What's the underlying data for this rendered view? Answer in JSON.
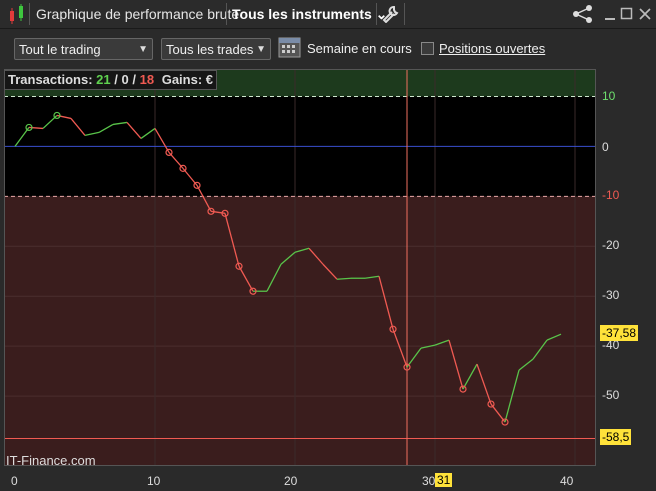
{
  "titlebar": {
    "title": "Graphique de performance brute",
    "instruments": "Tous les instruments ⌄",
    "colors": {
      "bg": "#2b2b2b"
    }
  },
  "toolbar": {
    "trading_select": "Tout le trading",
    "trades_select": "Tous les trades",
    "period_label": "Semaine en cours",
    "positions_label": "Positions ouvertes",
    "positions_checked": false
  },
  "info": {
    "label": "Transactions:",
    "wins": "21",
    "zero": "0",
    "losses": "18",
    "gains_label": "Gains: €",
    "sep": "/"
  },
  "watermark": "IT-Finance.com",
  "levels": {
    "upper": "10",
    "lower": "-10",
    "current": "-37,58",
    "min": "-58,5"
  },
  "crosshair_x_label": "31",
  "chart_data": {
    "type": "line",
    "x_ticks": [
      "0",
      "10",
      "20",
      "30",
      "40"
    ],
    "y_ticks": [
      "10",
      "0",
      "-10",
      "-20",
      "-30",
      "-40",
      "-50"
    ],
    "xlim": [
      0,
      41.5
    ],
    "ylim": [
      -64,
      15.5
    ],
    "x": [
      0,
      1,
      2,
      3,
      4,
      5,
      6,
      7,
      8,
      9,
      10,
      11,
      12,
      13,
      14,
      15,
      16,
      17,
      18,
      19,
      20,
      21,
      22,
      23,
      24,
      25,
      26,
      27,
      28,
      29,
      30,
      31,
      32,
      33,
      34,
      35,
      36,
      37,
      38,
      39
    ],
    "y": [
      0,
      3.8,
      3.6,
      6.2,
      5.6,
      2.2,
      2.8,
      4.4,
      4.8,
      1.6,
      3.6,
      -1.2,
      -4.4,
      -7.8,
      -13,
      -13.4,
      -24,
      -29,
      -29,
      -23.6,
      -21.2,
      -20.4,
      -23.6,
      -26.6,
      -26.4,
      -26.4,
      -26,
      -36.6,
      -44.2,
      -40.4,
      -39.8,
      -38.8,
      -48.6,
      -43.6,
      -51.6,
      -55.2,
      -44.8,
      -42.6,
      -38.8,
      -37.6
    ],
    "markers_x": [
      1,
      3,
      11,
      12,
      13,
      14,
      15,
      16,
      17,
      27,
      28,
      32,
      34,
      35
    ],
    "crosshair_x": 28,
    "colors": {
      "up": "#59c44a",
      "down": "#f05a52",
      "zero": "#3a4fd1",
      "upper_zone": "#000000",
      "lower_zone": "#3a1d1d"
    }
  }
}
